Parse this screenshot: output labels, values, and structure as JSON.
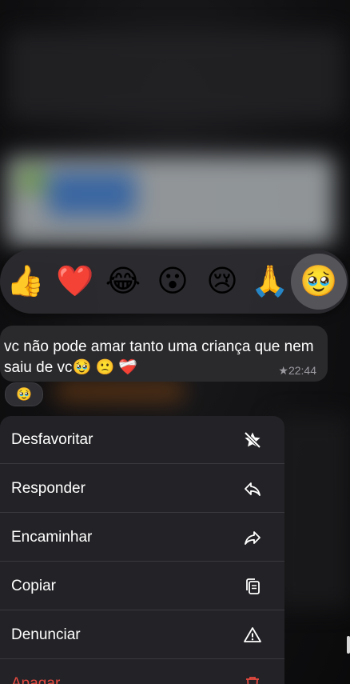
{
  "reactions": [
    {
      "name": "thumbs-up",
      "glyph": "👍"
    },
    {
      "name": "red-heart",
      "glyph": "❤️"
    },
    {
      "name": "tears-of-joy",
      "glyph": "😂"
    },
    {
      "name": "surprised",
      "glyph": "😮"
    },
    {
      "name": "crying",
      "glyph": "😢"
    },
    {
      "name": "folded-hands",
      "glyph": "🙏"
    },
    {
      "name": "pleading",
      "glyph": "🥹"
    }
  ],
  "message": {
    "text": "vc não pode amar tanto uma criança que nem saiu de vc🥹 🙁 ❤️‍🩹",
    "time": "★22:44",
    "reaction_chip": "🥹"
  },
  "menu": {
    "items": [
      {
        "label": "Desfavoritar",
        "icon": "unstar-icon"
      },
      {
        "label": "Responder",
        "icon": "reply-icon"
      },
      {
        "label": "Encaminhar",
        "icon": "forward-icon"
      },
      {
        "label": "Copiar",
        "icon": "copy-icon"
      },
      {
        "label": "Denunciar",
        "icon": "warning-icon"
      },
      {
        "label": "Apagar",
        "icon": "trash-icon"
      }
    ]
  },
  "colors": {
    "danger": "#e5493f",
    "menu_bg": "#242428",
    "bubble_bg": "#2a2a2d"
  }
}
